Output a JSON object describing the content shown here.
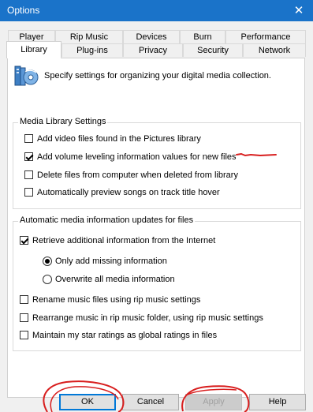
{
  "window": {
    "title": "Options",
    "close_glyph": "✕"
  },
  "tabs": {
    "row1": [
      "Player",
      "Rip Music",
      "Devices",
      "Burn",
      "Performance"
    ],
    "row2": [
      "Library",
      "Plug-ins",
      "Privacy",
      "Security",
      "Network"
    ],
    "active": "Library"
  },
  "header": {
    "icon": "media-library-icon",
    "description": "Specify settings for organizing your digital media collection."
  },
  "media_library_settings": {
    "title": "Media Library Settings",
    "options": [
      {
        "label": "Add video files found in the Pictures library",
        "checked": false
      },
      {
        "label": "Add volume leveling information values for new files",
        "checked": true
      },
      {
        "label": "Delete files from computer when deleted from library",
        "checked": false
      },
      {
        "label": "Automatically preview songs on track title hover",
        "checked": false
      }
    ]
  },
  "auto_updates": {
    "title": "Automatic media information updates for files",
    "retrieve": {
      "label": "Retrieve additional information from the Internet",
      "checked": true
    },
    "radios": [
      {
        "label": "Only add missing information",
        "selected": true
      },
      {
        "label": "Overwrite all media information",
        "selected": false
      }
    ],
    "options": [
      {
        "label": "Rename music files using rip music settings",
        "checked": false
      },
      {
        "label": "Rearrange music in rip music folder, using rip music settings",
        "checked": false
      },
      {
        "label": "Maintain my star ratings as global ratings in files",
        "checked": false
      }
    ]
  },
  "buttons": {
    "ok": "OK",
    "cancel": "Cancel",
    "apply": "Apply",
    "help": "Help"
  },
  "colors": {
    "titlebar": "#1a73c9",
    "annotation": "#d81e1e",
    "default_button_border": "#0078d7"
  }
}
